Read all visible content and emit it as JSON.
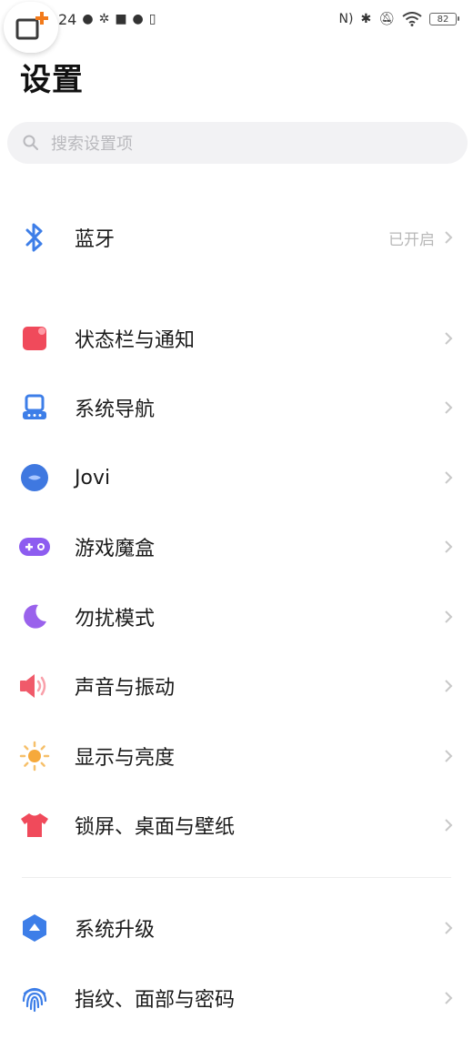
{
  "status_bar": {
    "time_partial": "24",
    "battery_level": "82"
  },
  "header": {
    "title": "设置"
  },
  "search": {
    "placeholder": "搜索设置项"
  },
  "rows": [
    {
      "label": "蓝牙",
      "value": "已开启",
      "icon": "bluetooth-icon",
      "color": "#3d7ee8"
    },
    {
      "label": "状态栏与通知",
      "icon": "status-bar-notification-icon",
      "color": "#f04a5b"
    },
    {
      "label": "系统导航",
      "icon": "system-navigation-icon",
      "color": "#3d7ee8"
    },
    {
      "label": "Jovi",
      "icon": "jovi-icon",
      "color": "#3f78e0"
    },
    {
      "label": "游戏魔盒",
      "icon": "game-box-icon",
      "color": "#8d5cf0"
    },
    {
      "label": "勿扰模式",
      "icon": "do-not-disturb-moon-icon",
      "color": "#9a62ec"
    },
    {
      "label": "声音与振动",
      "icon": "sound-vibration-icon",
      "color": "#f05a6a"
    },
    {
      "label": "显示与亮度",
      "icon": "display-brightness-sun-icon",
      "color": "#f6a93b"
    },
    {
      "label": "锁屏、桌面与壁纸",
      "icon": "lockscreen-wallpaper-shirt-icon",
      "color": "#f04a5b"
    },
    {
      "label": "系统升级",
      "icon": "system-upgrade-icon",
      "color": "#3d7ee8"
    },
    {
      "label": "指纹、面部与密码",
      "icon": "fingerprint-icon",
      "color": "#3d7ee8"
    }
  ]
}
